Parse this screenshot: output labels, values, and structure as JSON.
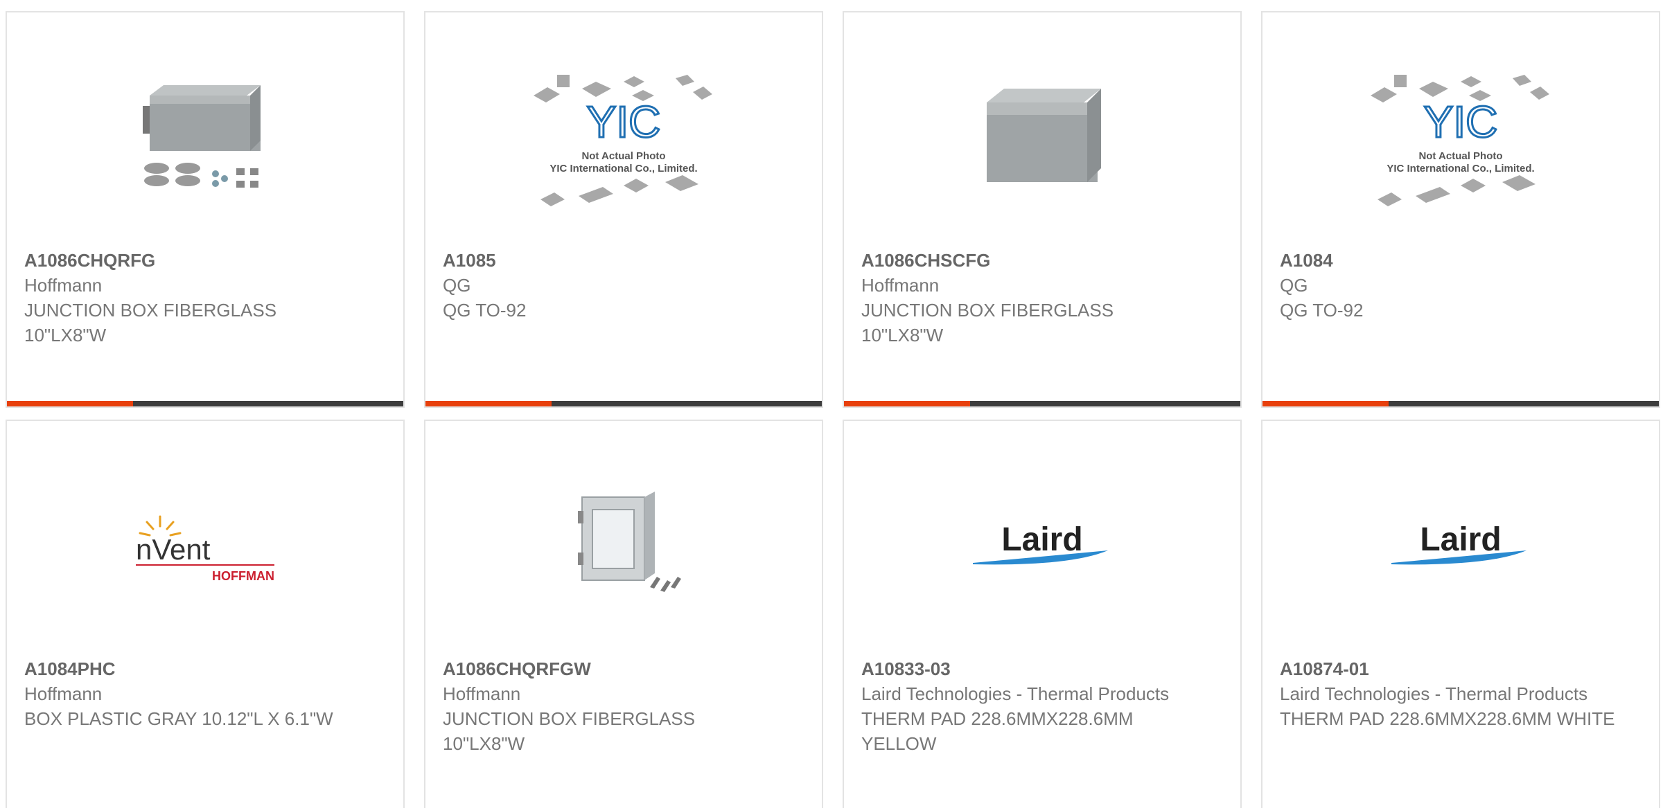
{
  "accent_color": "#e8400c",
  "bar_color": "#3d3d3d",
  "products": [
    {
      "part_number": "A1086CHQRFG",
      "manufacturer": "Hoffmann",
      "description": "JUNCTION BOX FIBERGLASS 10\"LX8\"W",
      "image": "enclosure-with-hardware-photo"
    },
    {
      "part_number": "A1085",
      "manufacturer": "QG",
      "description": "QG TO-92",
      "image": "yic-not-actual-photo",
      "image_text": {
        "brand": "YIC",
        "line1": "Not Actual Photo",
        "line2": "YIC International Co., Limited."
      }
    },
    {
      "part_number": "A1086CHSCFG",
      "manufacturer": "Hoffmann",
      "description": "JUNCTION BOX FIBERGLASS 10\"LX8\"W",
      "image": "enclosure-photo"
    },
    {
      "part_number": "A1084",
      "manufacturer": "QG",
      "description": "QG TO-92",
      "image": "yic-not-actual-photo",
      "image_text": {
        "brand": "YIC",
        "line1": "Not Actual Photo",
        "line2": "YIC International Co., Limited."
      }
    },
    {
      "part_number": "A1084PHC",
      "manufacturer": "Hoffmann",
      "description": "BOX PLASTIC GRAY 10.12\"L X 6.1\"W",
      "image": "nvent-hoffman-logo",
      "image_text": {
        "brand": "nVent",
        "sub": "HOFFMAN"
      }
    },
    {
      "part_number": "A1086CHQRFGW",
      "manufacturer": "Hoffmann",
      "description": "JUNCTION BOX FIBERGLASS 10\"LX8\"W",
      "image": "window-enclosure-photo"
    },
    {
      "part_number": "A10833-03",
      "manufacturer": "Laird Technologies - Thermal Products",
      "description": "THERM PAD 228.6MMX228.6MM YELLOW",
      "image": "laird-logo",
      "image_text": {
        "brand": "Laird"
      }
    },
    {
      "part_number": "A10874-01",
      "manufacturer": "Laird Technologies - Thermal Products",
      "description": "THERM PAD 228.6MMX228.6MM WHITE",
      "image": "laird-logo",
      "image_text": {
        "brand": "Laird"
      }
    }
  ]
}
